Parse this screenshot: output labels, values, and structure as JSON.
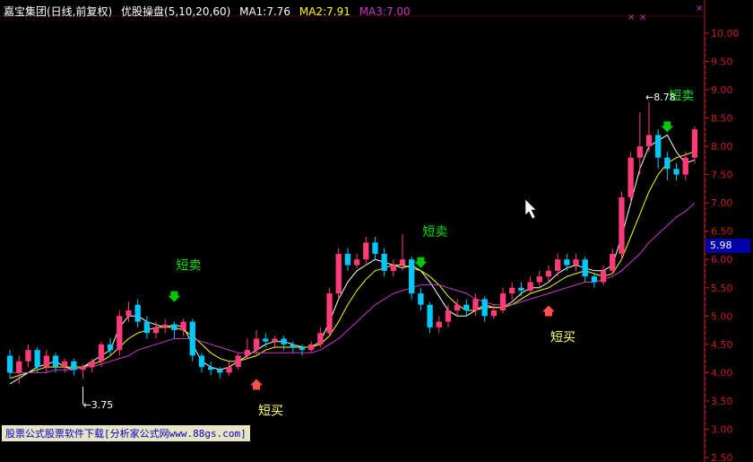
{
  "header": {
    "stock_name": "嘉宝集团(日线,前复权)",
    "indicator_name": "优股操盘(5,10,20,60)",
    "ma1_label": "MA1:7.76",
    "ma2_label": "MA2:7.91",
    "ma3_label": "MA3:7.00"
  },
  "current_price_tag": "5.98",
  "footer_text": "股票公式股票软件下载[分析家公式网www.88gs.com]",
  "colors": {
    "up": "#ff3c78",
    "down": "#00c8ff",
    "ma1": "#ffffff",
    "ma2": "#ffff00",
    "ma3": "#c838c8",
    "axis": "#c81e1e",
    "sell_arrow": "#00c800",
    "buy_arrow": "#ff5050",
    "sell_label": "#00e000",
    "buy_label": "#ffff64"
  },
  "chart_data": {
    "type": "candlestick",
    "ylim": [
      2.5,
      10.3
    ],
    "y_ticks": [
      "10.00",
      "9.50",
      "9.00",
      "8.50",
      "8.00",
      "7.50",
      "7.00",
      "6.50",
      "6.00",
      "5.50",
      "5.00",
      "4.50",
      "4.00",
      "3.50",
      "3.00",
      "2.50"
    ],
    "series": [
      {
        "name": "MA1",
        "values": [
          3.8,
          3.9,
          4.0,
          4.1,
          4.15,
          4.2,
          4.1,
          4.05,
          4.1,
          4.2,
          4.3,
          4.4,
          4.8,
          5.0,
          5.0,
          4.9,
          4.85,
          4.8,
          4.85,
          4.8,
          4.5,
          4.2,
          4.1,
          4.05,
          4.1,
          4.2,
          4.3,
          4.4,
          4.5,
          4.55,
          4.55,
          4.5,
          4.45,
          4.45,
          4.55,
          4.9,
          5.3,
          5.6,
          5.8,
          5.9,
          6.0,
          5.95,
          5.9,
          5.85,
          5.9,
          5.8,
          5.6,
          5.35,
          5.1,
          5.0,
          5.0,
          5.1,
          5.2,
          5.15,
          5.15,
          5.25,
          5.4,
          5.5,
          5.5,
          5.6,
          5.75,
          5.85,
          5.9,
          5.85,
          5.8,
          5.8,
          5.9,
          6.4,
          7.0,
          7.6,
          8.0,
          8.1,
          8.2,
          7.9,
          7.7,
          7.76
        ]
      },
      {
        "name": "MA2",
        "values": [
          3.9,
          3.95,
          4.0,
          4.05,
          4.1,
          4.1,
          4.1,
          4.1,
          4.1,
          4.15,
          4.2,
          4.3,
          4.45,
          4.6,
          4.7,
          4.75,
          4.8,
          4.8,
          4.8,
          4.75,
          4.65,
          4.5,
          4.35,
          4.25,
          4.2,
          4.2,
          4.25,
          4.3,
          4.4,
          4.45,
          4.45,
          4.45,
          4.45,
          4.45,
          4.5,
          4.65,
          4.9,
          5.2,
          5.45,
          5.65,
          5.8,
          5.85,
          5.9,
          5.9,
          5.85,
          5.8,
          5.7,
          5.55,
          5.35,
          5.2,
          5.1,
          5.1,
          5.15,
          5.15,
          5.15,
          5.2,
          5.3,
          5.4,
          5.45,
          5.5,
          5.6,
          5.7,
          5.75,
          5.8,
          5.75,
          5.7,
          5.75,
          6.0,
          6.4,
          6.8,
          7.2,
          7.5,
          7.7,
          7.8,
          7.85,
          7.91
        ]
      },
      {
        "name": "MA3",
        "values": [
          4.0,
          4.0,
          4.0,
          4.0,
          4.0,
          4.05,
          4.05,
          4.05,
          4.1,
          4.1,
          4.15,
          4.2,
          4.25,
          4.3,
          4.4,
          4.45,
          4.5,
          4.55,
          4.6,
          4.6,
          4.6,
          4.55,
          4.5,
          4.45,
          4.4,
          4.35,
          4.35,
          4.35,
          4.35,
          4.35,
          4.35,
          4.35,
          4.35,
          4.35,
          4.4,
          4.5,
          4.6,
          4.75,
          4.9,
          5.05,
          5.2,
          5.3,
          5.4,
          5.45,
          5.5,
          5.55,
          5.55,
          5.55,
          5.5,
          5.45,
          5.4,
          5.3,
          5.25,
          5.2,
          5.2,
          5.2,
          5.25,
          5.3,
          5.35,
          5.4,
          5.45,
          5.5,
          5.55,
          5.6,
          5.6,
          5.65,
          5.7,
          5.8,
          5.95,
          6.1,
          6.3,
          6.45,
          6.6,
          6.75,
          6.85,
          7.0
        ]
      }
    ],
    "candles": [
      [
        4.3,
        4.0,
        4.4,
        3.9
      ],
      [
        4.0,
        4.2,
        4.3,
        3.8
      ],
      [
        4.2,
        4.4,
        4.5,
        4.1
      ],
      [
        4.4,
        4.1,
        4.45,
        4.0
      ],
      [
        4.1,
        4.3,
        4.4,
        4.0
      ],
      [
        4.3,
        4.1,
        4.35,
        4.0
      ],
      [
        4.1,
        4.2,
        4.25,
        4.0
      ],
      [
        4.2,
        4.05,
        4.25,
        3.95
      ],
      [
        4.05,
        4.1,
        4.15,
        3.9
      ],
      [
        4.1,
        4.2,
        4.25,
        4.0
      ],
      [
        4.2,
        4.5,
        4.55,
        4.1
      ],
      [
        4.5,
        4.4,
        4.6,
        4.3
      ],
      [
        4.4,
        5.0,
        5.1,
        4.3
      ],
      [
        5.0,
        5.1,
        5.25,
        4.9
      ],
      [
        5.2,
        4.9,
        5.3,
        4.8
      ],
      [
        4.9,
        4.7,
        5.0,
        4.6
      ],
      [
        4.7,
        4.8,
        4.9,
        4.6
      ],
      [
        4.8,
        4.85,
        4.95,
        4.7
      ],
      [
        4.85,
        4.75,
        4.9,
        4.6
      ],
      [
        4.75,
        4.9,
        4.95,
        4.65
      ],
      [
        4.9,
        4.3,
        4.95,
        4.2
      ],
      [
        4.3,
        4.1,
        4.35,
        4.0
      ],
      [
        4.1,
        4.05,
        4.2,
        3.95
      ],
      [
        4.05,
        4.0,
        4.1,
        3.9
      ],
      [
        4.0,
        4.1,
        4.2,
        3.95
      ],
      [
        4.1,
        4.3,
        4.35,
        4.05
      ],
      [
        4.3,
        4.4,
        4.6,
        4.25
      ],
      [
        4.4,
        4.6,
        4.75,
        4.3
      ],
      [
        4.6,
        4.55,
        4.7,
        4.45
      ],
      [
        4.55,
        4.6,
        4.65,
        4.45
      ],
      [
        4.6,
        4.5,
        4.65,
        4.4
      ],
      [
        4.5,
        4.45,
        4.55,
        4.35
      ],
      [
        4.45,
        4.4,
        4.5,
        4.3
      ],
      [
        4.4,
        4.5,
        4.55,
        4.35
      ],
      [
        4.5,
        4.7,
        4.8,
        4.45
      ],
      [
        4.7,
        5.4,
        5.5,
        4.65
      ],
      [
        5.4,
        6.1,
        6.2,
        5.3
      ],
      [
        6.1,
        5.9,
        6.2,
        5.8
      ],
      [
        5.9,
        6.0,
        6.1,
        5.85
      ],
      [
        6.0,
        6.3,
        6.4,
        5.9
      ],
      [
        6.3,
        6.1,
        6.4,
        6.0
      ],
      [
        6.1,
        5.8,
        6.2,
        5.7
      ],
      [
        5.8,
        5.9,
        6.0,
        5.7
      ],
      [
        5.9,
        6.0,
        6.45,
        5.8
      ],
      [
        6.0,
        5.4,
        6.05,
        5.3
      ],
      [
        5.4,
        5.2,
        5.5,
        5.1
      ],
      [
        5.2,
        4.8,
        5.25,
        4.7
      ],
      [
        4.8,
        4.9,
        5.0,
        4.7
      ],
      [
        4.9,
        5.1,
        5.2,
        4.8
      ],
      [
        5.1,
        5.2,
        5.3,
        5.0
      ],
      [
        5.2,
        5.1,
        5.3,
        5.0
      ],
      [
        5.1,
        5.3,
        5.4,
        5.0
      ],
      [
        5.3,
        5.0,
        5.35,
        4.9
      ],
      [
        5.0,
        5.1,
        5.2,
        4.95
      ],
      [
        5.1,
        5.4,
        5.5,
        5.05
      ],
      [
        5.4,
        5.5,
        5.6,
        5.3
      ],
      [
        5.5,
        5.45,
        5.6,
        5.35
      ],
      [
        5.45,
        5.6,
        5.7,
        5.4
      ],
      [
        5.6,
        5.7,
        5.8,
        5.5
      ],
      [
        5.7,
        5.8,
        5.9,
        5.6
      ],
      [
        5.8,
        6.0,
        6.1,
        5.7
      ],
      [
        6.0,
        5.9,
        6.1,
        5.8
      ],
      [
        5.9,
        6.0,
        6.1,
        5.8
      ],
      [
        6.0,
        5.7,
        6.05,
        5.6
      ],
      [
        5.7,
        5.6,
        5.75,
        5.5
      ],
      [
        5.6,
        5.8,
        5.9,
        5.55
      ],
      [
        5.8,
        6.1,
        6.2,
        5.75
      ],
      [
        6.1,
        7.1,
        7.2,
        6.0
      ],
      [
        7.1,
        7.8,
        7.9,
        7.0
      ],
      [
        7.8,
        8.0,
        8.6,
        7.5
      ],
      [
        8.0,
        8.2,
        8.78,
        7.9
      ],
      [
        8.2,
        7.8,
        8.3,
        7.6
      ],
      [
        7.8,
        7.6,
        7.9,
        7.4
      ],
      [
        7.6,
        7.5,
        7.7,
        7.4
      ],
      [
        7.5,
        7.8,
        7.9,
        7.4
      ],
      [
        7.8,
        8.3,
        8.35,
        7.7
      ]
    ],
    "annotations": [
      {
        "kind": "sell",
        "text": "短卖",
        "index": 18
      },
      {
        "kind": "buy",
        "text": "短买",
        "index": 27
      },
      {
        "kind": "sell",
        "text": "短卖",
        "index": 45
      },
      {
        "kind": "buy",
        "text": "短买",
        "index": 59
      },
      {
        "kind": "sell",
        "text": "短卖",
        "index": 72
      }
    ],
    "extremes": [
      {
        "text": "3.75",
        "index": 8,
        "value": 3.75
      },
      {
        "text": "8.78",
        "index": 70,
        "value": 8.78
      }
    ]
  }
}
